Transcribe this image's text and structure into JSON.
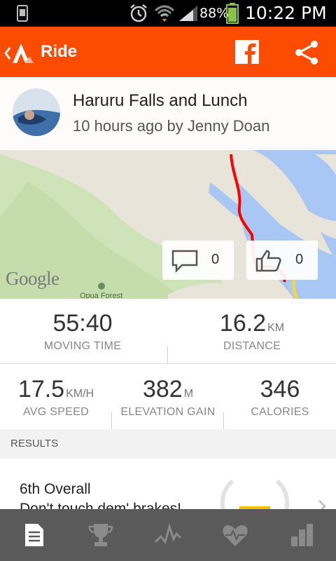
{
  "status_bar": {
    "battery_percent": "88%",
    "time": "10:22 PM",
    "icons": [
      "screenshot-icon",
      "alarm-icon",
      "wifi-icon",
      "signal-icon",
      "battery-icon"
    ]
  },
  "action_bar": {
    "title": "Ride",
    "icons": [
      "back-chevron-icon",
      "strava-logo-icon",
      "facebook-icon",
      "share-icon"
    ],
    "background": "#fc4c02"
  },
  "activity": {
    "title": "Haruru Falls and Lunch",
    "subtitle": "10 hours ago by Jenny Doan",
    "comments": "0",
    "kudos": "0"
  },
  "map": {
    "attribution": "Google",
    "place_label": "Opua Forest",
    "route_color": "#ff0000"
  },
  "stats": {
    "moving_time": {
      "value": "55:40",
      "label": "MOVING TIME"
    },
    "distance": {
      "value": "16.2",
      "unit": "KM",
      "label": "DISTANCE"
    },
    "avg_speed": {
      "value": "17.5",
      "unit": "KM/H",
      "label": "AVG SPEED"
    },
    "elevation": {
      "value": "382",
      "unit": "M",
      "label": "ELEVATION GAIN"
    },
    "calories": {
      "value": "346",
      "label": "CALORIES"
    }
  },
  "results": {
    "header": "RESULTS",
    "items": [
      {
        "line1": "6th Overall",
        "line2": "Don't touch dem' brakes!",
        "rank": "6"
      }
    ]
  },
  "bottom_nav": {
    "tabs": [
      "overview-icon",
      "trophy-icon",
      "analysis-icon",
      "heart-rate-icon",
      "stats-icon"
    ],
    "active": "overview-icon"
  }
}
